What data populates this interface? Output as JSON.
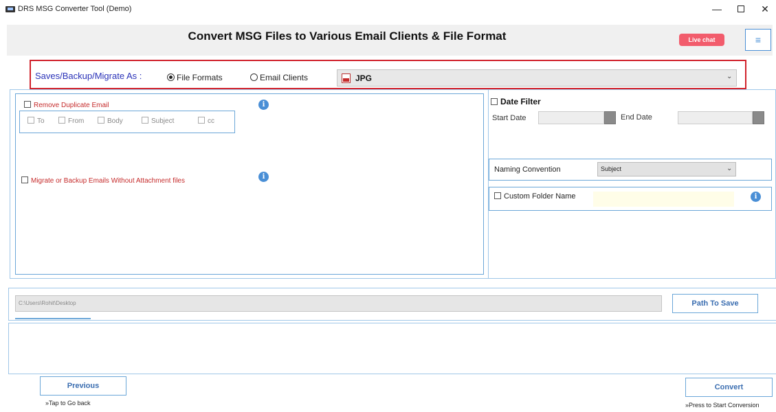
{
  "window": {
    "title": "DRS MSG Converter Tool (Demo)",
    "minimize": "—",
    "close": "✕"
  },
  "header": {
    "title": "Convert MSG Files to Various Email Clients & File Format",
    "live_chat": "Live chat",
    "menu_icon": "≡"
  },
  "saveas": {
    "label": "Saves/Backup/Migrate As :",
    "option_file": "File Formats",
    "option_email": "Email Clients",
    "selected_option": "File Formats",
    "format_value": "JPG"
  },
  "options": {
    "remove_duplicate": "Remove Duplicate Email",
    "fields": [
      "To",
      "From",
      "Body",
      "Subject",
      "cc"
    ],
    "no_attachments": "Migrate or Backup Emails Without Attachment files",
    "info_glyph": "i"
  },
  "date_filter": {
    "label": "Date Filter",
    "start_label": "Start Date",
    "end_label": "End Date"
  },
  "naming": {
    "label": "Naming Convention",
    "value": "Subject"
  },
  "custom_folder": {
    "label": "Custom Folder Name"
  },
  "path": {
    "value": "C:\\Users\\Rohit\\Desktop",
    "button": "Path To Save"
  },
  "nav": {
    "previous": "Previous",
    "previous_hint": "»Tap to Go back",
    "convert": "Convert",
    "convert_hint": "»Press to Start Conversion"
  },
  "colors": {
    "accent_blue": "#4a8fd6",
    "highlight_red": "#d0202a",
    "live_chat": "#f25c6c",
    "label_red": "#c52a2a",
    "label_blue": "#2a32b8"
  }
}
